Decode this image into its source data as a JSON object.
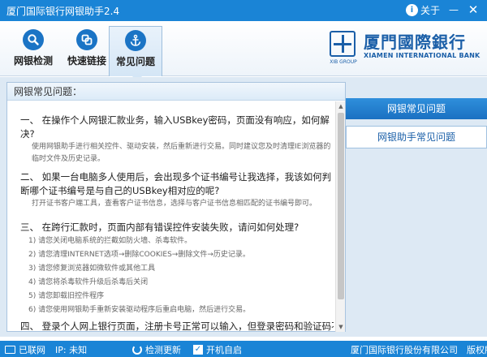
{
  "window": {
    "title": "厦门国际银行网银助手2.4",
    "about_label": "关于",
    "minimize_glyph": "—",
    "close_glyph": "✕"
  },
  "toolbar": {
    "items": [
      {
        "label": "网银检测",
        "icon": "search-icon"
      },
      {
        "label": "快速链接",
        "icon": "link-icon"
      },
      {
        "label": "常见问题",
        "icon": "anchor-icon"
      }
    ],
    "active_index": 2
  },
  "logo": {
    "cn": "厦門國際銀行",
    "en": "XIAMEN INTERNATIONAL BANK",
    "group": "XIB GROUP"
  },
  "panel": {
    "title": "网银常见问题："
  },
  "faq": [
    {
      "q": "一、 在操作个人网银汇款业务，输入USBkey密码，页面没有响应，如何解决?",
      "a": "使用网银助手进行相关控件、驱动安装，然后重新进行交易。同时建议您及时清理IE浏览器的临时文件及历史记录。"
    },
    {
      "q": "二、 如果一台电脑多人使用后，会出现多个证书编号让我选择，我该如何判断哪个证书编号是与自己的USBkey相对应的呢?",
      "a": "打开证书客户端工具，查看客户证书信息，选择与客户证书信息相匹配的证书编号即可。"
    },
    {
      "q": "三、 在跨行汇款时，页面内部有错误控件安装失败，请问如何处理?",
      "steps": [
        "1)  请您关闭电脑系统的拦截如防火墙、杀毒软件。",
        "2)  请您清理INTERNET选项→删除COOKIES→删除文件→历史记录。",
        "3)  请您修复浏览器如微软件或其他工具",
        "4)  请您将杀毒软件升级后杀毒后关闭",
        "5)  请您卸载旧控件程序",
        "6)  请您使用网银助手重新安装驱动程序后重启电脑，然后进行交易。"
      ]
    },
    {
      "q": "四、 登录个人网上银行页面，注册卡号正常可以输入，但登录密码和验证码不可"
    }
  ],
  "nav": {
    "items": [
      "网银常见问题",
      "网银助手常见问题"
    ],
    "active_index": 0
  },
  "status": {
    "connection": "已联网",
    "ip_label": "IP: 未知",
    "update_label": "检测更新",
    "autostart_label": "开机自启",
    "autostart_checked": true,
    "copyright": "厦门国际银行股份有限公司　版权所有"
  },
  "colors": {
    "title_bar": "#1a84d6",
    "nav_active": "#1a70c2",
    "content_bg": "#dde9f4",
    "brand": "#1b5fa8"
  }
}
